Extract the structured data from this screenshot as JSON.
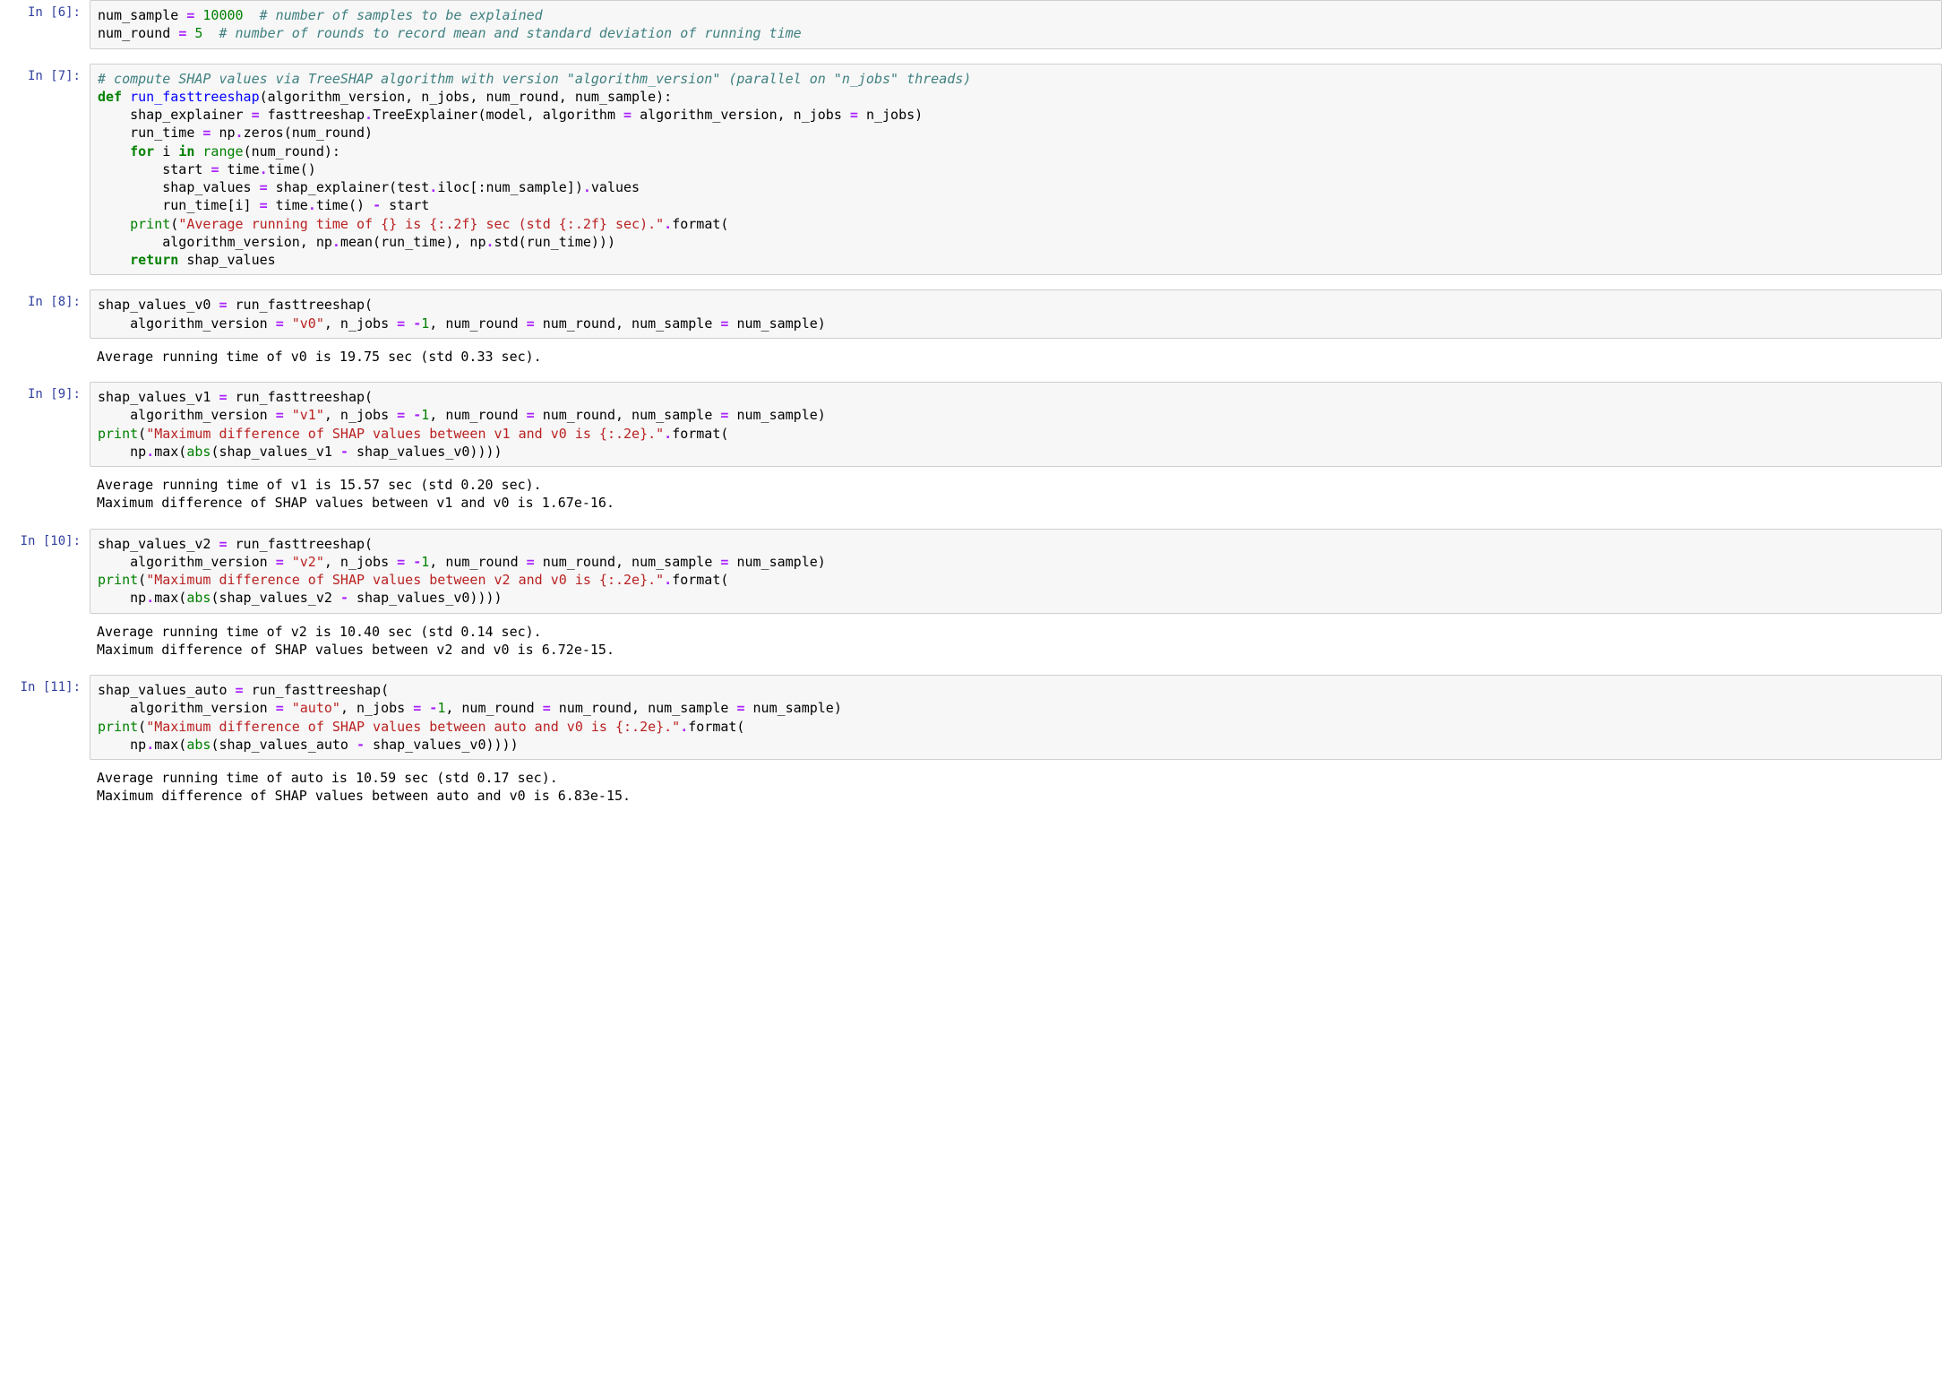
{
  "cells": [
    {
      "prompt": "In [6]:",
      "code_html": "<span class='blk'>num_sample </span><span class='op'>=</span><span class='blk'> </span><span class='num'>10000</span><span class='blk'>  </span><span class='cm'># number of samples to be explained</span>\n<span class='blk'>num_round </span><span class='op'>=</span><span class='blk'> </span><span class='num'>5</span><span class='blk'>  </span><span class='cm'># number of rounds to record mean and standard deviation of running time</span>",
      "output": ""
    },
    {
      "prompt": "In [7]:",
      "code_html": "<span class='cm'># compute SHAP values via TreeSHAP algorithm with version \"algorithm_version\" (parallel on \"n_jobs\" threads)</span>\n<span class='kw'>def</span><span class='blk'> </span><span class='fn'>run_fasttreeshap</span><span class='blk'>(algorithm_version, n_jobs, num_round, num_sample):</span>\n<span class='blk'>    shap_explainer </span><span class='op'>=</span><span class='blk'> fasttreeshap</span><span class='op'>.</span><span class='blk'>TreeExplainer(model, algorithm </span><span class='op'>=</span><span class='blk'> algorithm_version, n_jobs </span><span class='op'>=</span><span class='blk'> n_jobs)</span>\n<span class='blk'>    run_time </span><span class='op'>=</span><span class='blk'> np</span><span class='op'>.</span><span class='blk'>zeros(num_round)</span>\n<span class='blk'>    </span><span class='kw'>for</span><span class='blk'> i </span><span class='kw'>in</span><span class='blk'> </span><span class='bi'>range</span><span class='blk'>(num_round):</span>\n<span class='blk'>        start </span><span class='op'>=</span><span class='blk'> time</span><span class='op'>.</span><span class='blk'>time()</span>\n<span class='blk'>        shap_values </span><span class='op'>=</span><span class='blk'> shap_explainer(test</span><span class='op'>.</span><span class='blk'>iloc[:num_sample])</span><span class='op'>.</span><span class='blk'>values</span>\n<span class='blk'>        run_time[i] </span><span class='op'>=</span><span class='blk'> time</span><span class='op'>.</span><span class='blk'>time() </span><span class='op'>-</span><span class='blk'> start</span>\n<span class='blk'>    </span><span class='bi'>print</span><span class='blk'>(</span><span class='s'>\"Average running time of {} is {:.2f} sec (std {:.2f} sec).\"</span><span class='op'>.</span><span class='blk'>format(</span>\n<span class='blk'>        algorithm_version, np</span><span class='op'>.</span><span class='blk'>mean(run_time), np</span><span class='op'>.</span><span class='blk'>std(run_time)))</span>\n<span class='blk'>    </span><span class='kw'>return</span><span class='blk'> shap_values</span>",
      "output": ""
    },
    {
      "prompt": "In [8]:",
      "code_html": "<span class='blk'>shap_values_v0 </span><span class='op'>=</span><span class='blk'> run_fasttreeshap(</span>\n<span class='blk'>    algorithm_version </span><span class='op'>=</span><span class='blk'> </span><span class='s'>\"v0\"</span><span class='blk'>, n_jobs </span><span class='op'>=</span><span class='blk'> </span><span class='op'>-</span><span class='num'>1</span><span class='blk'>, num_round </span><span class='op'>=</span><span class='blk'> num_round, num_sample </span><span class='op'>=</span><span class='blk'> num_sample)</span>",
      "output": "Average running time of v0 is 19.75 sec (std 0.33 sec)."
    },
    {
      "prompt": "In [9]:",
      "code_html": "<span class='blk'>shap_values_v1 </span><span class='op'>=</span><span class='blk'> run_fasttreeshap(</span>\n<span class='blk'>    algorithm_version </span><span class='op'>=</span><span class='blk'> </span><span class='s'>\"v1\"</span><span class='blk'>, n_jobs </span><span class='op'>=</span><span class='blk'> </span><span class='op'>-</span><span class='num'>1</span><span class='blk'>, num_round </span><span class='op'>=</span><span class='blk'> num_round, num_sample </span><span class='op'>=</span><span class='blk'> num_sample)</span>\n<span class='bi'>print</span><span class='blk'>(</span><span class='s'>\"Maximum difference of SHAP values between v1 and v0 is {:.2e}.\"</span><span class='op'>.</span><span class='blk'>format(</span>\n<span class='blk'>    np</span><span class='op'>.</span><span class='blk'>max(</span><span class='bi'>abs</span><span class='blk'>(shap_values_v1 </span><span class='op'>-</span><span class='blk'> shap_values_v0))))</span>",
      "output": "Average running time of v1 is 15.57 sec (std 0.20 sec).\nMaximum difference of SHAP values between v1 and v0 is 1.67e-16."
    },
    {
      "prompt": "In [10]:",
      "code_html": "<span class='blk'>shap_values_v2 </span><span class='op'>=</span><span class='blk'> run_fasttreeshap(</span>\n<span class='blk'>    algorithm_version </span><span class='op'>=</span><span class='blk'> </span><span class='s'>\"v2\"</span><span class='blk'>, n_jobs </span><span class='op'>=</span><span class='blk'> </span><span class='op'>-</span><span class='num'>1</span><span class='blk'>, num_round </span><span class='op'>=</span><span class='blk'> num_round, num_sample </span><span class='op'>=</span><span class='blk'> num_sample)</span>\n<span class='bi'>print</span><span class='blk'>(</span><span class='s'>\"Maximum difference of SHAP values between v2 and v0 is {:.2e}.\"</span><span class='op'>.</span><span class='blk'>format(</span>\n<span class='blk'>    np</span><span class='op'>.</span><span class='blk'>max(</span><span class='bi'>abs</span><span class='blk'>(shap_values_v2 </span><span class='op'>-</span><span class='blk'> shap_values_v0))))</span>",
      "output": "Average running time of v2 is 10.40 sec (std 0.14 sec).\nMaximum difference of SHAP values between v2 and v0 is 6.72e-15."
    },
    {
      "prompt": "In [11]:",
      "code_html": "<span class='blk'>shap_values_auto </span><span class='op'>=</span><span class='blk'> run_fasttreeshap(</span>\n<span class='blk'>    algorithm_version </span><span class='op'>=</span><span class='blk'> </span><span class='s'>\"auto\"</span><span class='blk'>, n_jobs </span><span class='op'>=</span><span class='blk'> </span><span class='op'>-</span><span class='num'>1</span><span class='blk'>, num_round </span><span class='op'>=</span><span class='blk'> num_round, num_sample </span><span class='op'>=</span><span class='blk'> num_sample)</span>\n<span class='bi'>print</span><span class='blk'>(</span><span class='s'>\"Maximum difference of SHAP values between auto and v0 is {:.2e}.\"</span><span class='op'>.</span><span class='blk'>format(</span>\n<span class='blk'>    np</span><span class='op'>.</span><span class='blk'>max(</span><span class='bi'>abs</span><span class='blk'>(shap_values_auto </span><span class='op'>-</span><span class='blk'> shap_values_v0))))</span>",
      "output": "Average running time of auto is 10.59 sec (std 0.17 sec).\nMaximum difference of SHAP values between auto and v0 is 6.83e-15."
    }
  ]
}
